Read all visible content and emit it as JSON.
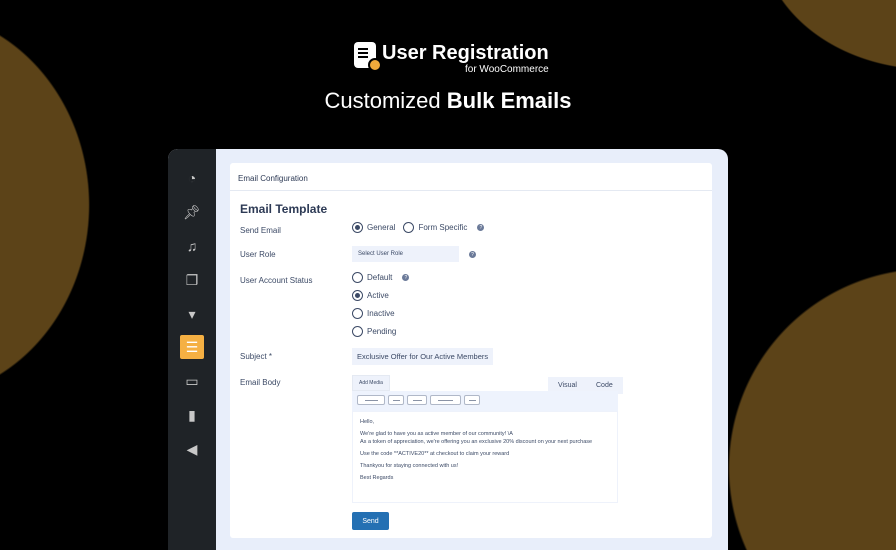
{
  "brand": {
    "name": "User Registration",
    "sub": "for WooCommerce"
  },
  "headline": {
    "light": "Customized ",
    "bold": "Bulk Emails"
  },
  "sidebar": [
    "dashboard-icon",
    "pin-icon",
    "media-icon",
    "pages-icon",
    "comments-icon",
    "user-registration-icon",
    "archive-icon",
    "analytics-icon",
    "megaphone-icon"
  ],
  "card": {
    "header": "Email Configuration",
    "title": "Email Template",
    "send_email": {
      "label": "Send Email",
      "options": [
        "General",
        "Form Specific"
      ]
    },
    "user_role": {
      "label": "User Role",
      "placeholder": "Select User Role"
    },
    "status": {
      "label": "User Account Status",
      "options": [
        "Default",
        "Active",
        "Inactive",
        "Pending"
      ]
    },
    "subject": {
      "label": "Subject *",
      "value": "Exclusive Offer for Our Active Members"
    },
    "body": {
      "label": "Email Body",
      "add_media": "Add Media",
      "tab_visual": "Visual",
      "tab_code": "Code",
      "lines": [
        "Hello,",
        "We're glad to have you as active member of our community! \\A",
        "As a token of appreciation, we're offering you an exclusive 20% discount on your next purchase",
        "Use the code **ACTIVE20** at checkout to claim your reward",
        "Thankyou for staying connected with us!",
        "Best Regards"
      ]
    },
    "send": "Send"
  },
  "help": "?"
}
